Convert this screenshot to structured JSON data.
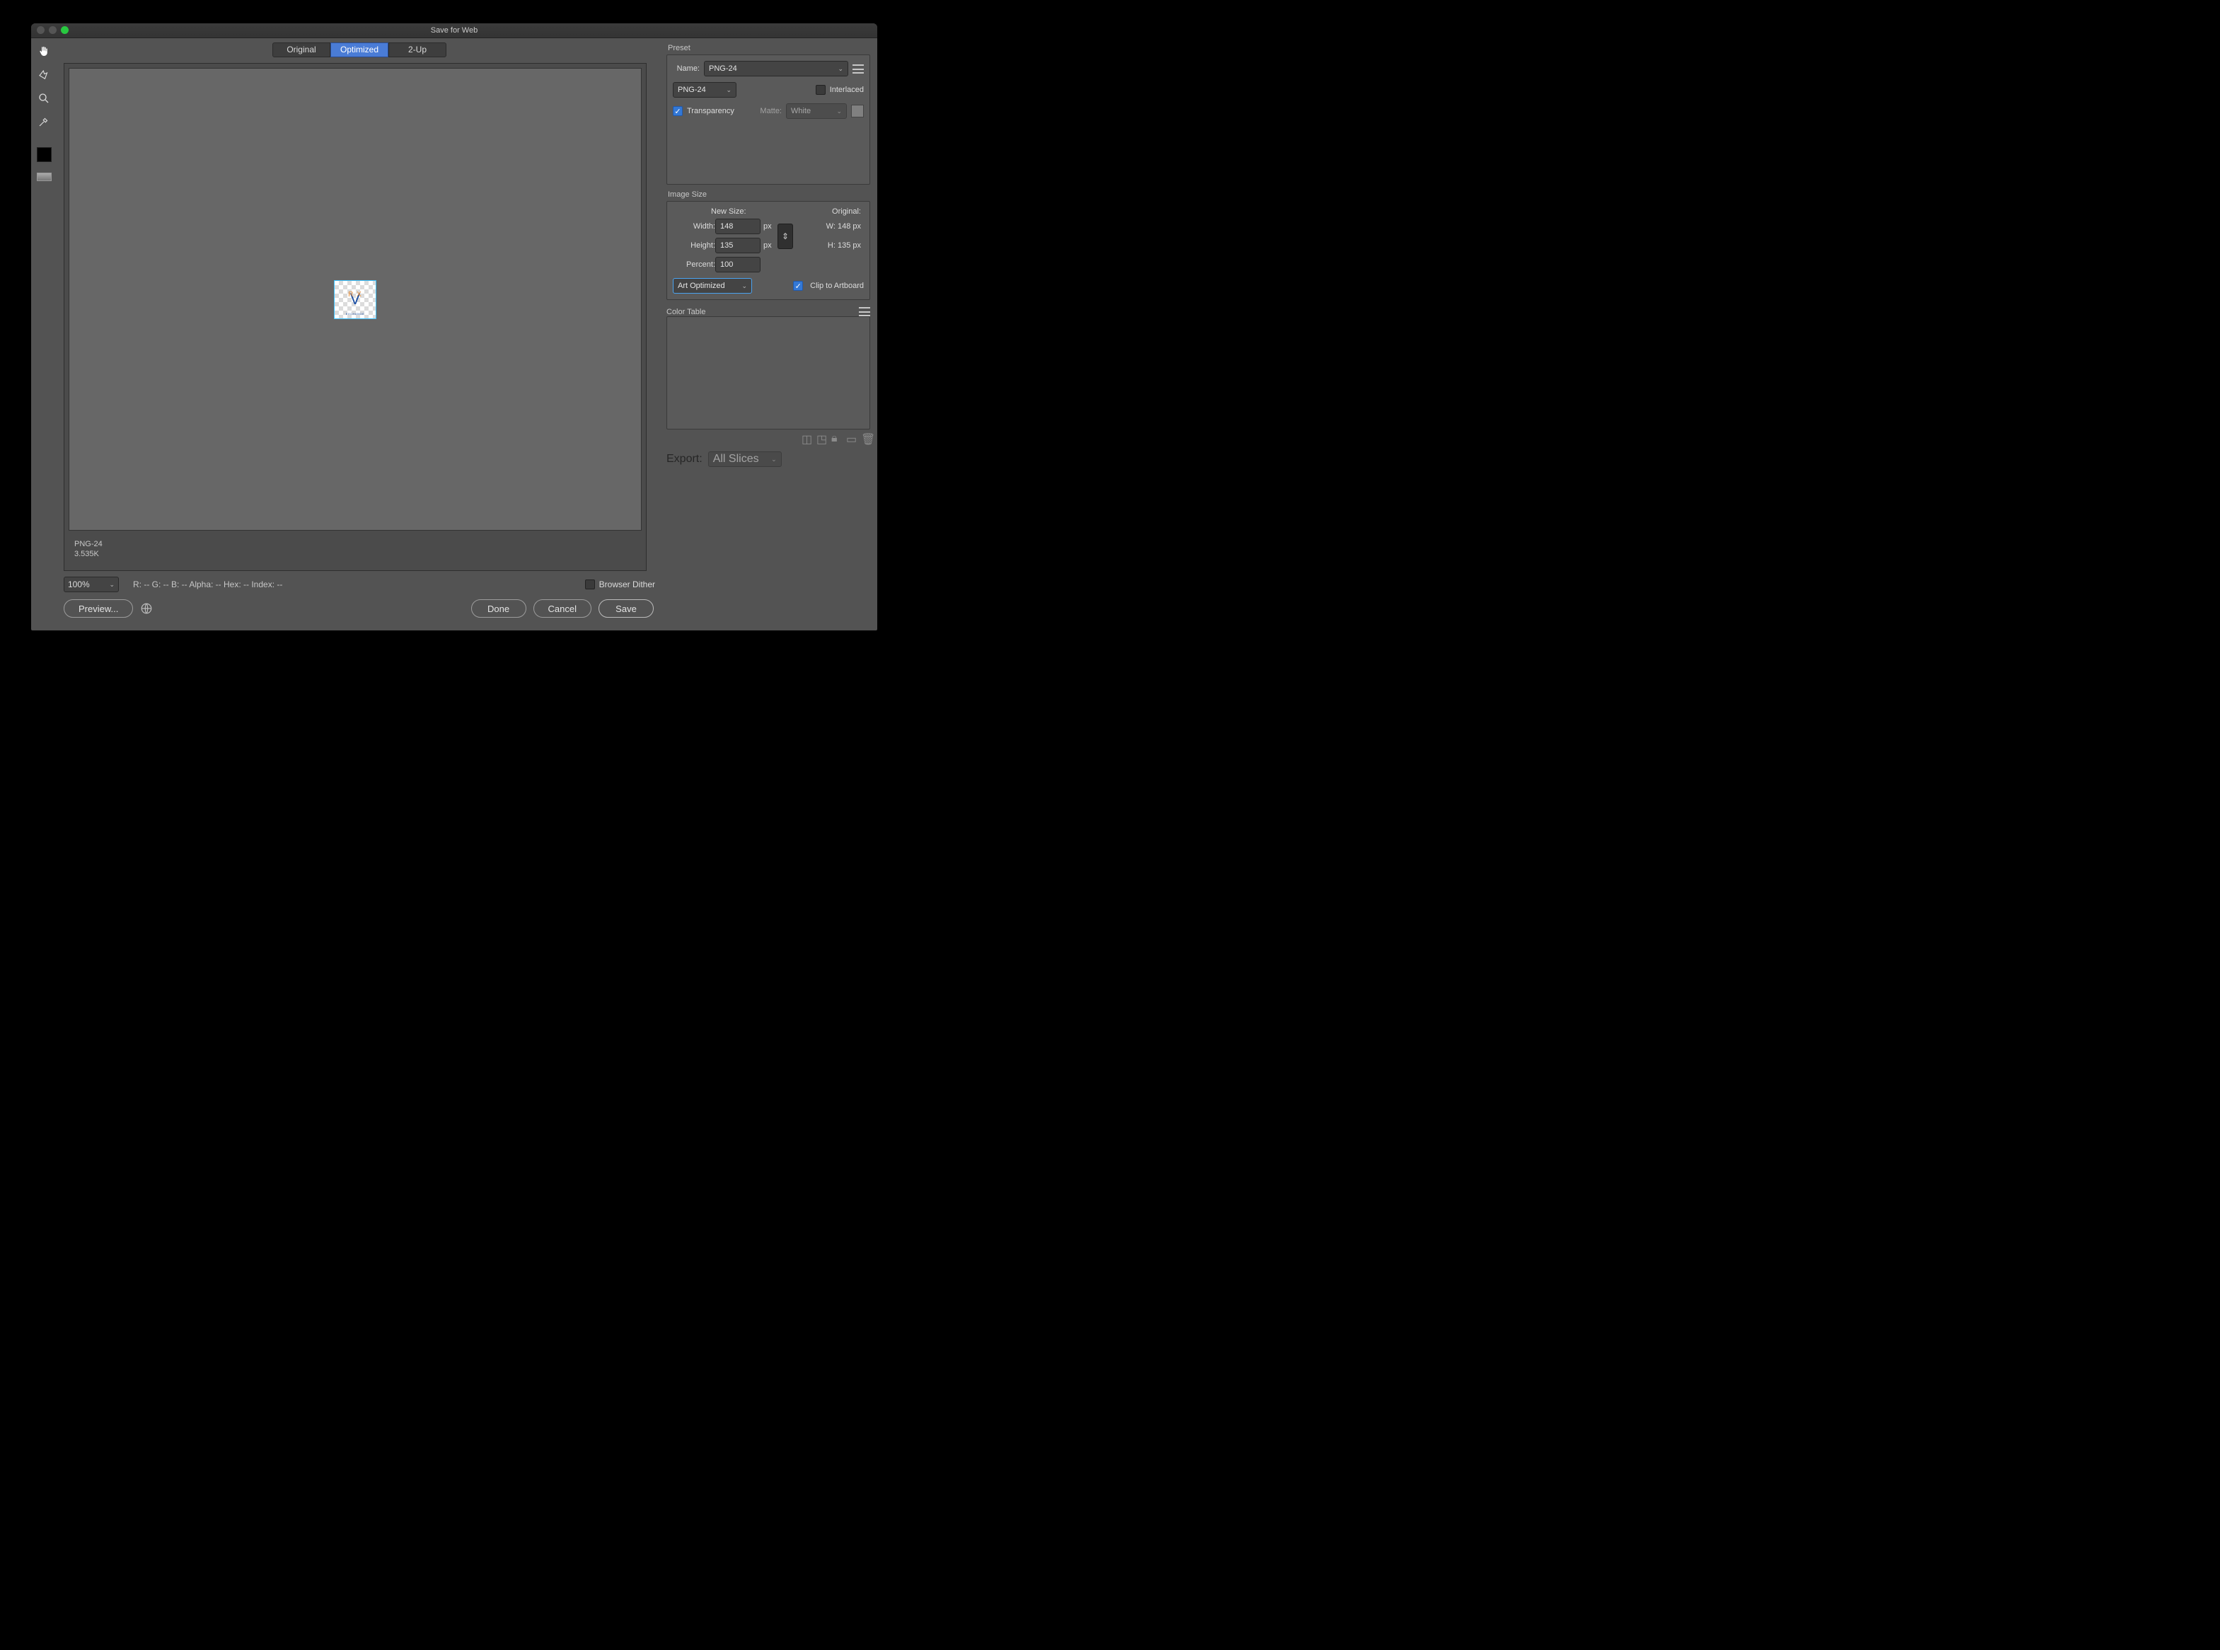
{
  "window": {
    "title": "Save for Web"
  },
  "tabs": {
    "original": "Original",
    "optimized": "Optimized",
    "two_up": "2-Up"
  },
  "preview": {
    "logo_v": "V",
    "logo_rx": "R  X",
    "logo_ex": "EXCHANGE",
    "format_line": "PNG-24",
    "size_line": "3.535K"
  },
  "status": {
    "zoom": "100%",
    "readout": "R:  --   G:  --   B:  --   Alpha:  --   Hex:  --   Index:  --",
    "browser_dither_label": "Browser Dither"
  },
  "buttons": {
    "preview": "Preview...",
    "done": "Done",
    "cancel": "Cancel",
    "save": "Save"
  },
  "preset": {
    "section": "Preset",
    "name_label": "Name:",
    "name_value": "PNG-24",
    "format_value": "PNG-24",
    "interlaced_label": "Interlaced",
    "transparency_label": "Transparency",
    "matte_label": "Matte:",
    "matte_value": "White"
  },
  "image_size": {
    "section": "Image Size",
    "new_size_header": "New Size:",
    "original_header": "Original:",
    "width_label": "Width:",
    "width_value": "148",
    "height_label": "Height:",
    "height_value": "135",
    "px": "px",
    "percent_label": "Percent:",
    "percent_value": "100",
    "orig_w": "W:  148 px",
    "orig_h": "H:  135 px",
    "quality_value": "Art Optimized",
    "clip_label": "Clip to Artboard"
  },
  "color_table": {
    "section": "Color Table"
  },
  "export": {
    "label": "Export:",
    "value": "All Slices"
  }
}
